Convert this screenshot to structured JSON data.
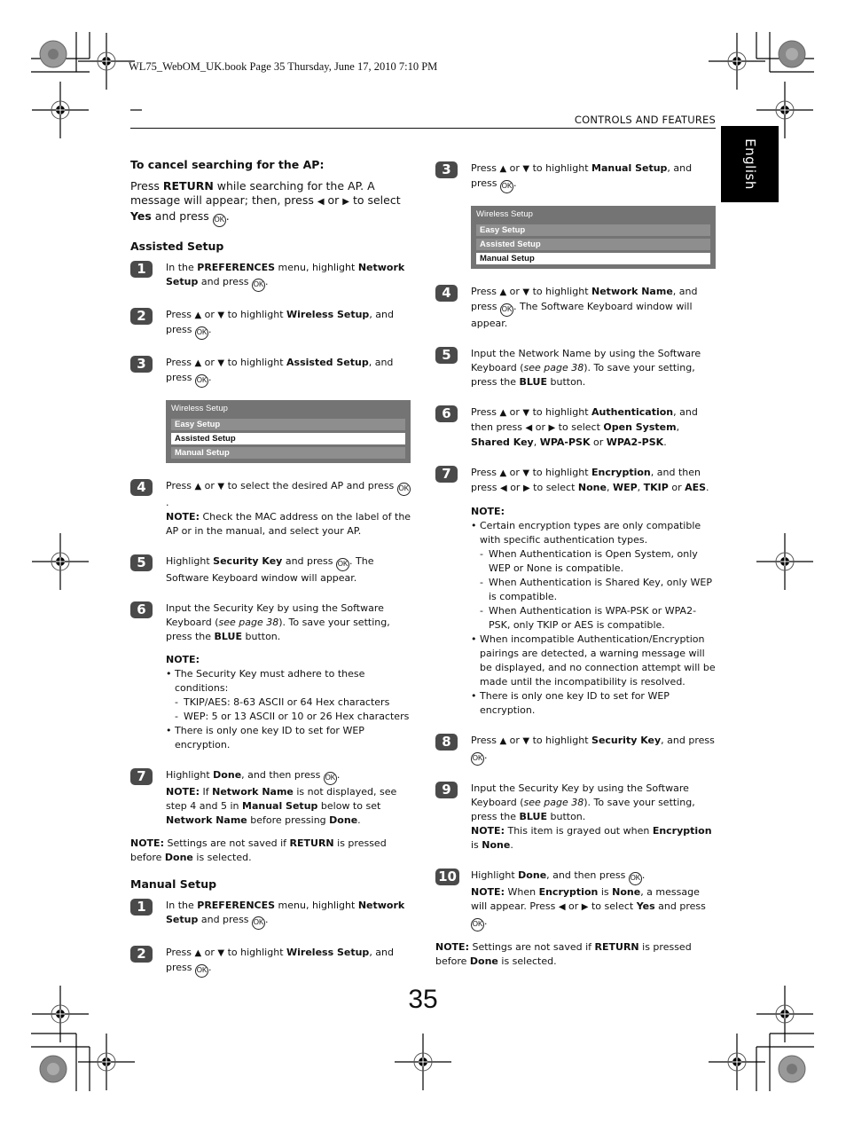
{
  "print_info": "WL75_WebOM_UK.book  Page 35  Thursday, June 17, 2010  7:10 PM",
  "header": {
    "section_title": "CONTROLS AND FEATURES",
    "language_tab": "English"
  },
  "page_number": "35",
  "icons": {
    "ok_button": "OK",
    "up": "▲",
    "down": "▼",
    "left": "◀",
    "right": "▶"
  },
  "left_column": {
    "cancel_heading": "To cancel searching for the AP:",
    "cancel_text": [
      "Press ",
      "RETURN",
      " while searching for the AP. A message will appear; then, press ",
      " or ",
      " to select ",
      "Yes",
      " and press ",
      "."
    ],
    "assisted_heading": "Assisted Setup",
    "assisted_steps": [
      {
        "num": "1",
        "parts": [
          "In the ",
          "PREFERENCES",
          " menu, highlight ",
          "Network Setup",
          " and press ",
          "."
        ]
      },
      {
        "num": "2",
        "parts": [
          "Press ",
          " or ",
          " to highlight ",
          "Wireless Setup",
          ", and press ",
          "."
        ]
      },
      {
        "num": "3",
        "parts": [
          "Press ",
          " or ",
          " to highlight ",
          "Assisted Setup",
          ", and press ",
          "."
        ]
      },
      {
        "num": "4",
        "parts": [
          "Press ",
          " or ",
          " to select the desired AP and press ",
          "."
        ],
        "note": [
          "NOTE:",
          " Check the MAC address on the label of the AP or in the manual, and select your AP."
        ]
      },
      {
        "num": "5",
        "parts": [
          "Highlight ",
          "Security Key",
          " and press ",
          ". The Software Keyboard window will appear."
        ]
      },
      {
        "num": "6",
        "parts": [
          "Input the Security Key by using the Software Keyboard (",
          "see page 38",
          "). To save your setting, press the ",
          "BLUE",
          " button."
        ],
        "note_title": "NOTE:",
        "note_items": [
          {
            "type": "bullet",
            "text": "The Security Key must adhere to these conditions:"
          },
          {
            "type": "dash",
            "text": "TKIP/AES: 8-63 ASCII or 64 Hex characters"
          },
          {
            "type": "dash",
            "text": "WEP: 5 or 13 ASCII or 10 or 26 Hex characters"
          },
          {
            "type": "bullet",
            "text": "There is only one key ID to set for WEP encryption."
          }
        ]
      },
      {
        "num": "7",
        "parts": [
          "Highlight ",
          "Done",
          ", and then press ",
          "."
        ],
        "note": [
          "NOTE:",
          " If ",
          "Network Name",
          " is not displayed, see step 4 and 5 in ",
          "Manual Setup",
          " below to set ",
          "Network Name",
          " before pressing ",
          "Done",
          "."
        ]
      }
    ],
    "menu": {
      "title": "Wireless Setup",
      "items": [
        "Easy Setup",
        "Assisted Setup",
        "Manual Setup"
      ],
      "selected": "Assisted Setup"
    },
    "final_note": [
      "NOTE:",
      " Settings are not saved if ",
      "RETURN",
      " is pressed before ",
      "Done",
      " is selected."
    ],
    "manual_heading": "Manual Setup",
    "manual_steps": [
      {
        "num": "1",
        "parts": [
          "In the ",
          "PREFERENCES",
          " menu, highlight ",
          "Network Setup",
          " and press ",
          "."
        ]
      },
      {
        "num": "2",
        "parts": [
          "Press ",
          " or ",
          " to highlight ",
          "Wireless Setup",
          ", and press ",
          "."
        ]
      }
    ]
  },
  "right_column": {
    "steps": [
      {
        "num": "3",
        "parts": [
          "Press ",
          " or ",
          " to highlight ",
          "Manual Setup",
          ", and press ",
          "."
        ]
      },
      {
        "num": "4",
        "parts": [
          "Press ",
          " or ",
          " to highlight ",
          "Network Name",
          ", and press ",
          ". The Software Keyboard window will appear."
        ]
      },
      {
        "num": "5",
        "parts": [
          "Input the Network Name by using the Software Keyboard (",
          "see page 38",
          "). To save your setting, press the ",
          "BLUE",
          " button."
        ]
      },
      {
        "num": "6",
        "parts": [
          "Press ",
          " or ",
          " to highlight ",
          "Authentication",
          ", and then press ",
          " or ",
          " to select ",
          "Open System",
          ", ",
          "Shared Key",
          ", ",
          "WPA-PSK",
          " or ",
          "WPA2-PSK",
          "."
        ]
      },
      {
        "num": "7",
        "parts": [
          "Press ",
          " or ",
          " to highlight ",
          "Encryption",
          ", and then press ",
          " or ",
          " to select ",
          "None",
          ", ",
          "WEP",
          ", ",
          "TKIP",
          " or ",
          "AES",
          "."
        ],
        "note_title": "NOTE:",
        "note_items": [
          {
            "type": "bullet",
            "text": "Certain encryption types are only compatible with specific authentication types."
          },
          {
            "type": "dash",
            "text": "When Authentication is Open System, only WEP or None is compatible."
          },
          {
            "type": "dash",
            "text": "When Authentication is Shared Key, only WEP is compatible."
          },
          {
            "type": "dash",
            "text": "When Authentication is WPA-PSK or WPA2-PSK, only TKIP or AES is compatible."
          },
          {
            "type": "bullet",
            "text": "When incompatible Authentication/Encryption pairings are detected, a warning message will be displayed, and no connection attempt will be made until the incompatibility is resolved."
          },
          {
            "type": "bullet",
            "text": "There is only one key ID to set for WEP encryption."
          }
        ]
      },
      {
        "num": "8",
        "parts": [
          "Press ",
          " or ",
          " to highlight ",
          "Security Key",
          ", and press ",
          "."
        ]
      },
      {
        "num": "9",
        "parts": [
          "Input the Security Key by using the Software Keyboard (",
          "see page 38",
          "). To save your setting, press the ",
          "BLUE",
          " button."
        ],
        "note": [
          "NOTE:",
          " This item is grayed out when ",
          "Encryption",
          " is ",
          "None",
          "."
        ]
      },
      {
        "num": "10",
        "parts": [
          "Highlight ",
          "Done",
          ", and then press ",
          "."
        ],
        "note": [
          "NOTE:",
          " When ",
          "Encryption",
          " is ",
          "None",
          ", a message will appear. Press ",
          " or ",
          " to select ",
          "Yes",
          " and press ",
          "."
        ]
      }
    ],
    "menu": {
      "title": "Wireless Setup",
      "items": [
        "Easy Setup",
        "Assisted Setup",
        "Manual Setup"
      ],
      "selected": "Manual Setup"
    },
    "final_note": [
      "NOTE:",
      " Settings are not saved if ",
      "RETURN",
      " is pressed before ",
      "Done",
      " is selected."
    ]
  }
}
